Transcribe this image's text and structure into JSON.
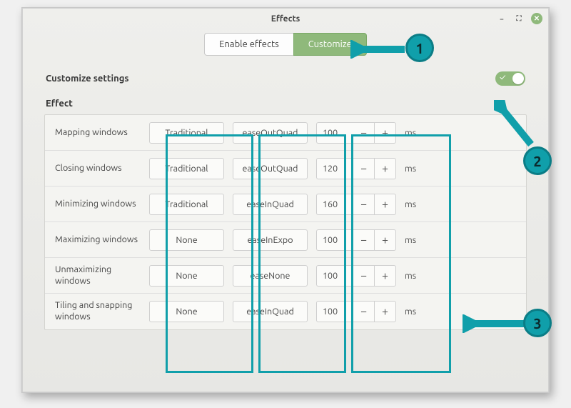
{
  "window": {
    "title": "Effects"
  },
  "window_buttons": {
    "min": "−",
    "max": "⛶",
    "close": "✕"
  },
  "tabs": {
    "enable": "Enable effects",
    "customize": "Customize"
  },
  "customize_header": "Customize settings",
  "section_title": "Effect",
  "unit": "ms",
  "toggle_check": "✓",
  "minus": "−",
  "plus": "+",
  "rows": [
    {
      "name": "Mapping windows",
      "style": "Traditional",
      "ease": "easeOutQuad",
      "ms": "100"
    },
    {
      "name": "Closing windows",
      "style": "Traditional",
      "ease": "easeOutQuad",
      "ms": "120"
    },
    {
      "name": "Minimizing windows",
      "style": "Traditional",
      "ease": "easeInQuad",
      "ms": "160"
    },
    {
      "name": "Maximizing windows",
      "style": "None",
      "ease": "easeInExpo",
      "ms": "100"
    },
    {
      "name": "Unmaximizing windows",
      "style": "None",
      "ease": "easeNone",
      "ms": "100"
    },
    {
      "name": "Tiling and snapping windows",
      "style": "None",
      "ease": "easeInQuad",
      "ms": "100"
    }
  ],
  "annotations": {
    "n1": "1",
    "n2": "2",
    "n3": "3"
  }
}
